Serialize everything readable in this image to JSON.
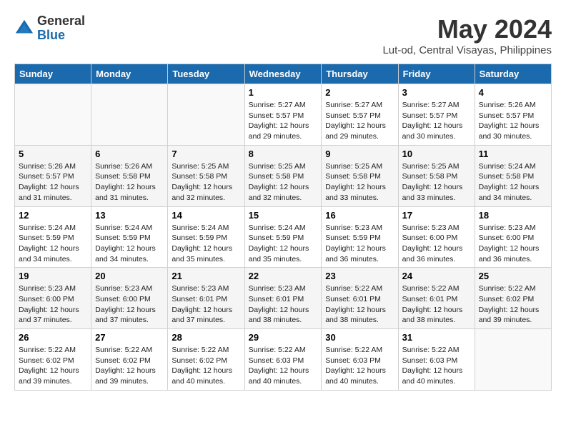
{
  "logo": {
    "general": "General",
    "blue": "Blue"
  },
  "title": {
    "month_year": "May 2024",
    "location": "Lut-od, Central Visayas, Philippines"
  },
  "headers": [
    "Sunday",
    "Monday",
    "Tuesday",
    "Wednesday",
    "Thursday",
    "Friday",
    "Saturday"
  ],
  "weeks": [
    [
      {
        "day": "",
        "info": ""
      },
      {
        "day": "",
        "info": ""
      },
      {
        "day": "",
        "info": ""
      },
      {
        "day": "1",
        "info": "Sunrise: 5:27 AM\nSunset: 5:57 PM\nDaylight: 12 hours\nand 29 minutes."
      },
      {
        "day": "2",
        "info": "Sunrise: 5:27 AM\nSunset: 5:57 PM\nDaylight: 12 hours\nand 29 minutes."
      },
      {
        "day": "3",
        "info": "Sunrise: 5:27 AM\nSunset: 5:57 PM\nDaylight: 12 hours\nand 30 minutes."
      },
      {
        "day": "4",
        "info": "Sunrise: 5:26 AM\nSunset: 5:57 PM\nDaylight: 12 hours\nand 30 minutes."
      }
    ],
    [
      {
        "day": "5",
        "info": "Sunrise: 5:26 AM\nSunset: 5:57 PM\nDaylight: 12 hours\nand 31 minutes."
      },
      {
        "day": "6",
        "info": "Sunrise: 5:26 AM\nSunset: 5:58 PM\nDaylight: 12 hours\nand 31 minutes."
      },
      {
        "day": "7",
        "info": "Sunrise: 5:25 AM\nSunset: 5:58 PM\nDaylight: 12 hours\nand 32 minutes."
      },
      {
        "day": "8",
        "info": "Sunrise: 5:25 AM\nSunset: 5:58 PM\nDaylight: 12 hours\nand 32 minutes."
      },
      {
        "day": "9",
        "info": "Sunrise: 5:25 AM\nSunset: 5:58 PM\nDaylight: 12 hours\nand 33 minutes."
      },
      {
        "day": "10",
        "info": "Sunrise: 5:25 AM\nSunset: 5:58 PM\nDaylight: 12 hours\nand 33 minutes."
      },
      {
        "day": "11",
        "info": "Sunrise: 5:24 AM\nSunset: 5:58 PM\nDaylight: 12 hours\nand 34 minutes."
      }
    ],
    [
      {
        "day": "12",
        "info": "Sunrise: 5:24 AM\nSunset: 5:59 PM\nDaylight: 12 hours\nand 34 minutes."
      },
      {
        "day": "13",
        "info": "Sunrise: 5:24 AM\nSunset: 5:59 PM\nDaylight: 12 hours\nand 34 minutes."
      },
      {
        "day": "14",
        "info": "Sunrise: 5:24 AM\nSunset: 5:59 PM\nDaylight: 12 hours\nand 35 minutes."
      },
      {
        "day": "15",
        "info": "Sunrise: 5:24 AM\nSunset: 5:59 PM\nDaylight: 12 hours\nand 35 minutes."
      },
      {
        "day": "16",
        "info": "Sunrise: 5:23 AM\nSunset: 5:59 PM\nDaylight: 12 hours\nand 36 minutes."
      },
      {
        "day": "17",
        "info": "Sunrise: 5:23 AM\nSunset: 6:00 PM\nDaylight: 12 hours\nand 36 minutes."
      },
      {
        "day": "18",
        "info": "Sunrise: 5:23 AM\nSunset: 6:00 PM\nDaylight: 12 hours\nand 36 minutes."
      }
    ],
    [
      {
        "day": "19",
        "info": "Sunrise: 5:23 AM\nSunset: 6:00 PM\nDaylight: 12 hours\nand 37 minutes."
      },
      {
        "day": "20",
        "info": "Sunrise: 5:23 AM\nSunset: 6:00 PM\nDaylight: 12 hours\nand 37 minutes."
      },
      {
        "day": "21",
        "info": "Sunrise: 5:23 AM\nSunset: 6:01 PM\nDaylight: 12 hours\nand 37 minutes."
      },
      {
        "day": "22",
        "info": "Sunrise: 5:23 AM\nSunset: 6:01 PM\nDaylight: 12 hours\nand 38 minutes."
      },
      {
        "day": "23",
        "info": "Sunrise: 5:22 AM\nSunset: 6:01 PM\nDaylight: 12 hours\nand 38 minutes."
      },
      {
        "day": "24",
        "info": "Sunrise: 5:22 AM\nSunset: 6:01 PM\nDaylight: 12 hours\nand 38 minutes."
      },
      {
        "day": "25",
        "info": "Sunrise: 5:22 AM\nSunset: 6:02 PM\nDaylight: 12 hours\nand 39 minutes."
      }
    ],
    [
      {
        "day": "26",
        "info": "Sunrise: 5:22 AM\nSunset: 6:02 PM\nDaylight: 12 hours\nand 39 minutes."
      },
      {
        "day": "27",
        "info": "Sunrise: 5:22 AM\nSunset: 6:02 PM\nDaylight: 12 hours\nand 39 minutes."
      },
      {
        "day": "28",
        "info": "Sunrise: 5:22 AM\nSunset: 6:02 PM\nDaylight: 12 hours\nand 40 minutes."
      },
      {
        "day": "29",
        "info": "Sunrise: 5:22 AM\nSunset: 6:03 PM\nDaylight: 12 hours\nand 40 minutes."
      },
      {
        "day": "30",
        "info": "Sunrise: 5:22 AM\nSunset: 6:03 PM\nDaylight: 12 hours\nand 40 minutes."
      },
      {
        "day": "31",
        "info": "Sunrise: 5:22 AM\nSunset: 6:03 PM\nDaylight: 12 hours\nand 40 minutes."
      },
      {
        "day": "",
        "info": ""
      }
    ]
  ]
}
